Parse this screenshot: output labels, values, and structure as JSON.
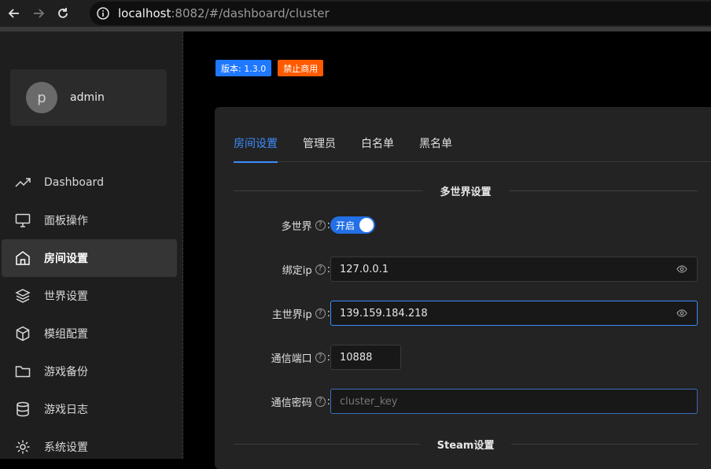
{
  "browser": {
    "url_host": "localhost",
    "url_rest": ":8082/#/dashboard/cluster"
  },
  "user": {
    "avatar_letter": "p",
    "name": "admin"
  },
  "sidebar": {
    "items": [
      {
        "label": "Dashboard",
        "icon": "trend-chart-icon"
      },
      {
        "label": "面板操作",
        "icon": "monitor-icon"
      },
      {
        "label": "房间设置",
        "icon": "home-icon",
        "active": true
      },
      {
        "label": "世界设置",
        "icon": "layers-icon"
      },
      {
        "label": "模组配置",
        "icon": "package-icon"
      },
      {
        "label": "游戏备份",
        "icon": "folder-icon"
      },
      {
        "label": "游戏日志",
        "icon": "database-icon"
      },
      {
        "label": "系统设置",
        "icon": "gear-icon"
      }
    ]
  },
  "badges": {
    "version": "版本: 1.3.0",
    "noncommercial": "禁止商用"
  },
  "tabs": [
    {
      "label": "房间设置",
      "active": true
    },
    {
      "label": "管理员"
    },
    {
      "label": "白名单"
    },
    {
      "label": "黑名单"
    }
  ],
  "sections": {
    "multiworld": "多世界设置",
    "steam": "Steam设置"
  },
  "form": {
    "multiworld": {
      "label": "多世界",
      "value": "开启",
      "enabled": true
    },
    "bind_ip": {
      "label": "绑定ip",
      "value": "127.0.0.1"
    },
    "master_ip": {
      "label": "主世界ip",
      "value": "139.159.184.218"
    },
    "port": {
      "label": "通信端口",
      "value": "10888"
    },
    "secret": {
      "label": "通信密码",
      "placeholder": "cluster_key"
    }
  },
  "colors": {
    "accent": "#3c8cff",
    "version_badge": "#1f78ff",
    "noncommercial_badge": "#ff5a00"
  }
}
